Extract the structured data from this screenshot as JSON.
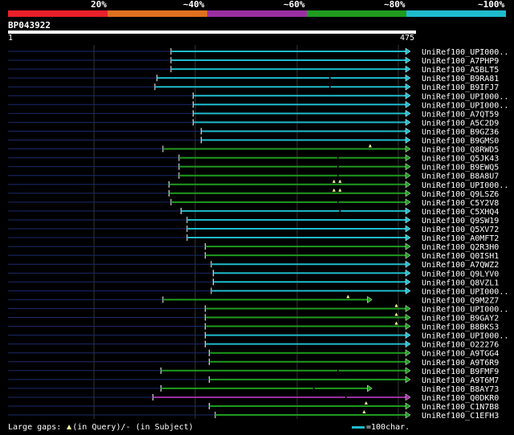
{
  "legend": {
    "labels": [
      "20%",
      "~40%",
      "~60%",
      "~80%",
      "~100%"
    ],
    "colors": [
      "#e8202a",
      "#e07020",
      "#9b2fa0",
      "#1f9b1f",
      "#1fbbcc"
    ]
  },
  "query": {
    "name": "BP043922",
    "start_label": "1",
    "end_label": "475"
  },
  "hits": [
    {
      "label": "UniRef100_UPI000..",
      "start": 0.405,
      "end": 1.0,
      "color": "#1fbbcc",
      "gaps": []
    },
    {
      "label": "UniRef100_A7PHP9",
      "start": 0.405,
      "end": 1.0,
      "color": "#1fbbcc",
      "gaps": []
    },
    {
      "label": "UniRef100_A5BLT5",
      "start": 0.405,
      "end": 1.0,
      "color": "#1fbbcc",
      "gaps": []
    },
    {
      "label": "UniRef100_B9RA81",
      "start": 0.37,
      "end": 1.0,
      "color": "#1fbbcc",
      "gaps": [
        {
          "pos": 0.8,
          "type": "subject"
        }
      ]
    },
    {
      "label": "UniRef100_B9IFJ7",
      "start": 0.365,
      "end": 1.0,
      "color": "#1fbbcc",
      "gaps": [
        {
          "pos": 0.8,
          "type": "subject"
        }
      ]
    },
    {
      "label": "UniRef100_UPI000..",
      "start": 0.46,
      "end": 1.0,
      "color": "#1fbbcc",
      "gaps": []
    },
    {
      "label": "UniRef100_UPI000..",
      "start": 0.46,
      "end": 1.0,
      "color": "#1fbbcc",
      "gaps": []
    },
    {
      "label": "UniRef100_A7QT59",
      "start": 0.46,
      "end": 1.0,
      "color": "#1fbbcc",
      "gaps": []
    },
    {
      "label": "UniRef100_A5C2D9",
      "start": 0.46,
      "end": 1.0,
      "color": "#1fbbcc",
      "gaps": []
    },
    {
      "label": "UniRef100_B9GZ36",
      "start": 0.48,
      "end": 1.0,
      "color": "#1fbbcc",
      "gaps": []
    },
    {
      "label": "UniRef100_B9GMS0",
      "start": 0.48,
      "end": 1.0,
      "color": "#1fbbcc",
      "gaps": []
    },
    {
      "label": "UniRef100_Q8RWD5",
      "start": 0.385,
      "end": 1.0,
      "color": "#1f9b1f",
      "gaps": [
        {
          "pos": 0.9,
          "type": "query"
        }
      ]
    },
    {
      "label": "UniRef100_Q5JK43",
      "start": 0.425,
      "end": 1.0,
      "color": "#1f9b1f",
      "gaps": [
        {
          "pos": 0.82,
          "type": "subject"
        }
      ]
    },
    {
      "label": "UniRef100_B9EWQ5",
      "start": 0.425,
      "end": 1.0,
      "color": "#1f9b1f",
      "gaps": [
        {
          "pos": 0.82,
          "type": "subject"
        }
      ]
    },
    {
      "label": "UniRef100_B8A8U7",
      "start": 0.425,
      "end": 1.0,
      "color": "#1f9b1f",
      "gaps": [
        {
          "pos": 0.82,
          "type": "subject"
        }
      ]
    },
    {
      "label": "UniRef100_UPI000..",
      "start": 0.4,
      "end": 1.0,
      "color": "#1f9b1f",
      "gaps": [
        {
          "pos": 0.81,
          "type": "query"
        },
        {
          "pos": 0.825,
          "type": "query"
        }
      ]
    },
    {
      "label": "UniRef100_Q9LSZ6",
      "start": 0.4,
      "end": 1.0,
      "color": "#1f9b1f",
      "gaps": [
        {
          "pos": 0.81,
          "type": "query"
        },
        {
          "pos": 0.825,
          "type": "query"
        }
      ]
    },
    {
      "label": "UniRef100_C5Y2V8",
      "start": 0.405,
      "end": 1.0,
      "color": "#1f9b1f",
      "gaps": [
        {
          "pos": 0.82,
          "type": "subject"
        }
      ]
    },
    {
      "label": "UniRef100_C5XHQ4",
      "start": 0.43,
      "end": 1.0,
      "color": "#1fbbcc",
      "gaps": [
        {
          "pos": 0.825,
          "type": "subject"
        }
      ]
    },
    {
      "label": "UniRef100_Q9SW19",
      "start": 0.445,
      "end": 1.0,
      "color": "#1fbbcc",
      "gaps": []
    },
    {
      "label": "UniRef100_Q5XV72",
      "start": 0.445,
      "end": 1.0,
      "color": "#1fbbcc",
      "gaps": []
    },
    {
      "label": "UniRef100_A0MFT2",
      "start": 0.445,
      "end": 1.0,
      "color": "#1fbbcc",
      "gaps": []
    },
    {
      "label": "UniRef100_Q2R3H0",
      "start": 0.49,
      "end": 1.0,
      "color": "#1f9b1f",
      "gaps": []
    },
    {
      "label": "UniRef100_Q0ISH1",
      "start": 0.49,
      "end": 1.0,
      "color": "#1f9b1f",
      "gaps": []
    },
    {
      "label": "UniRef100_A7QWZ2",
      "start": 0.505,
      "end": 1.0,
      "color": "#1fbbcc",
      "gaps": []
    },
    {
      "label": "UniRef100_Q9LYV0",
      "start": 0.51,
      "end": 1.0,
      "color": "#1fbbcc",
      "gaps": []
    },
    {
      "label": "UniRef100_Q8VZL1",
      "start": 0.51,
      "end": 1.0,
      "color": "#1fbbcc",
      "gaps": []
    },
    {
      "label": "UniRef100_UPI000..",
      "start": 0.505,
      "end": 1.0,
      "color": "#1fbbcc",
      "gaps": []
    },
    {
      "label": "UniRef100_Q9M2Z7",
      "start": 0.385,
      "end": 0.905,
      "color": "#1f9b1f",
      "gaps": [
        {
          "pos": 0.845,
          "type": "query"
        }
      ]
    },
    {
      "label": "UniRef100_UPI000..",
      "start": 0.49,
      "end": 1.0,
      "color": "#1f9b1f",
      "gaps": [
        {
          "pos": 0.965,
          "type": "query"
        }
      ]
    },
    {
      "label": "UniRef100_B9GAY2",
      "start": 0.49,
      "end": 1.0,
      "color": "#1f9b1f",
      "gaps": [
        {
          "pos": 0.965,
          "type": "query"
        }
      ]
    },
    {
      "label": "UniRef100_B8BKS3",
      "start": 0.49,
      "end": 1.0,
      "color": "#1f9b1f",
      "gaps": [
        {
          "pos": 0.965,
          "type": "query"
        }
      ]
    },
    {
      "label": "UniRef100_UPI000..",
      "start": 0.49,
      "end": 1.0,
      "color": "#1fbbcc",
      "gaps": []
    },
    {
      "label": "UniRef100_O22276",
      "start": 0.49,
      "end": 1.0,
      "color": "#1fbbcc",
      "gaps": []
    },
    {
      "label": "UniRef100_A9TGG4",
      "start": 0.5,
      "end": 1.0,
      "color": "#1f9b1f",
      "gaps": []
    },
    {
      "label": "UniRef100_A9T6R9",
      "start": 0.5,
      "end": 1.0,
      "color": "#1f9b1f",
      "gaps": []
    },
    {
      "label": "UniRef100_B9FMF9",
      "start": 0.38,
      "end": 1.0,
      "color": "#1f9b1f",
      "gaps": [
        {
          "pos": 0.82,
          "type": "subject"
        }
      ]
    },
    {
      "label": "UniRef100_A9T6M7",
      "start": 0.5,
      "end": 1.0,
      "color": "#1f9b1f",
      "gaps": []
    },
    {
      "label": "UniRef100_B8AY73",
      "start": 0.38,
      "end": 0.905,
      "color": "#1f9b1f",
      "gaps": [
        {
          "pos": 0.76,
          "type": "subject"
        }
      ]
    },
    {
      "label": "UniRef100_Q0DKR0",
      "start": 0.36,
      "end": 1.0,
      "color": "#9b2fa0",
      "gaps": [
        {
          "pos": 0.84,
          "type": "subject"
        }
      ]
    },
    {
      "label": "UniRef100_C1N7B8",
      "start": 0.5,
      "end": 1.0,
      "color": "#1f9b1f",
      "gaps": [
        {
          "pos": 0.89,
          "type": "query"
        }
      ]
    },
    {
      "label": "UniRef100_C1EFH3",
      "start": 0.515,
      "end": 1.0,
      "color": "#1f9b1f",
      "gaps": [
        {
          "pos": 0.885,
          "type": "query"
        }
      ]
    }
  ],
  "footer": {
    "gaps_label": "Large gaps:",
    "query_text": "(in Query)/",
    "subject_text": "(in Subject)",
    "scale_text": "=100char."
  }
}
